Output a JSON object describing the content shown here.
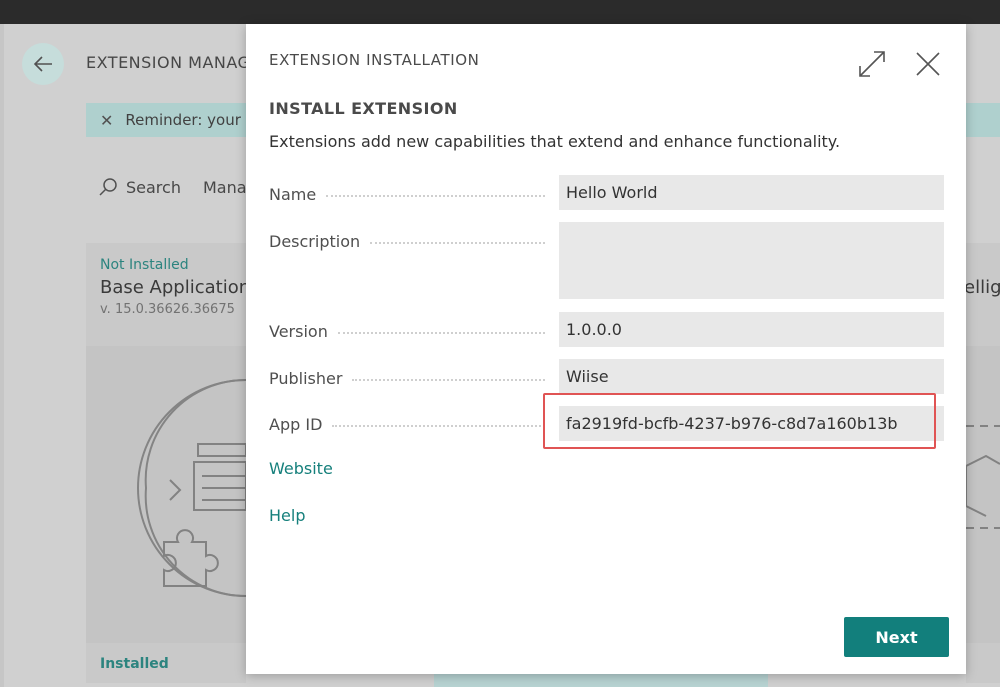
{
  "background": {
    "page_title": "EXTENSION MANAG",
    "reminder_text": "Reminder: your",
    "toolbar": {
      "search_label": "Search",
      "manage_label": "Mana"
    },
    "left_card": {
      "status": "Not Installed",
      "name": "Base Application",
      "version": "v. 15.0.36626.36675",
      "bottom_status": "Installed"
    },
    "right_card": {
      "name": "ellig"
    }
  },
  "dialog": {
    "caption": "EXTENSION INSTALLATION",
    "heading": "INSTALL EXTENSION",
    "description": "Extensions add new capabilities that extend and enhance functionality.",
    "fields": {
      "name": {
        "label": "Name",
        "value": "Hello World"
      },
      "description": {
        "label": "Description",
        "value": ""
      },
      "version": {
        "label": "Version",
        "value": "1.0.0.0"
      },
      "publisher": {
        "label": "Publisher",
        "value": "Wiise"
      },
      "app_id": {
        "label": "App ID",
        "value": "fa2919fd-bcfb-4237-b976-c8d7a160b13b"
      }
    },
    "links": {
      "website": "Website",
      "help": "Help"
    },
    "next_label": "Next"
  },
  "colors": {
    "accent": "#127f7c",
    "link": "#16807c",
    "highlight_border": "#e05454",
    "field_bg": "#e8e8e8"
  }
}
